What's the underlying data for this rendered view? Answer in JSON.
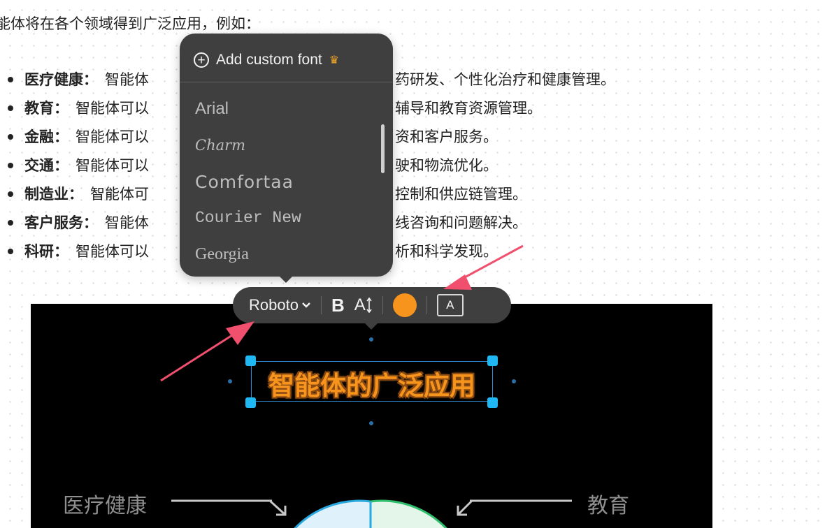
{
  "intro_text": "能体将在各个领域得到广泛应用，例如：",
  "bullets": [
    {
      "term": "医疗健康：",
      "text": "智能体",
      "tail": "药研发、个性化治疗和健康管理。"
    },
    {
      "term": "教育：",
      "text": "智能体可以",
      "tail": "辅导和教育资源管理。"
    },
    {
      "term": "金融：",
      "text": "智能体可以",
      "tail": "资和客户服务。"
    },
    {
      "term": "交通：",
      "text": "智能体可以",
      "tail": "驶和物流优化。"
    },
    {
      "term": "制造业：",
      "text": "智能体可",
      "tail": "控制和供应链管理。"
    },
    {
      "term": "客户服务：",
      "text": "智能体",
      "tail": "线咨询和问题解决。"
    },
    {
      "term": "科研：",
      "text": "智能体可以",
      "tail": "析和科学发现。"
    }
  ],
  "font_menu": {
    "add_label": "Add custom font",
    "plus_icon": "plus-circle-icon",
    "crown_icon": "crown-icon",
    "fonts": [
      "Arial",
      "Charm",
      "Comfortaa",
      "Courier New",
      "Georgia"
    ]
  },
  "toolbar": {
    "font_name": "Roboto",
    "bold_label": "B",
    "size_label": "A",
    "color": "#f7941d",
    "textbox_label": "A"
  },
  "canvas": {
    "title": "智能体的广泛应用",
    "left_label": "医疗健康",
    "right_label": "教育",
    "accent_color": "#f7941d",
    "selection_color": "#20b7f5"
  }
}
